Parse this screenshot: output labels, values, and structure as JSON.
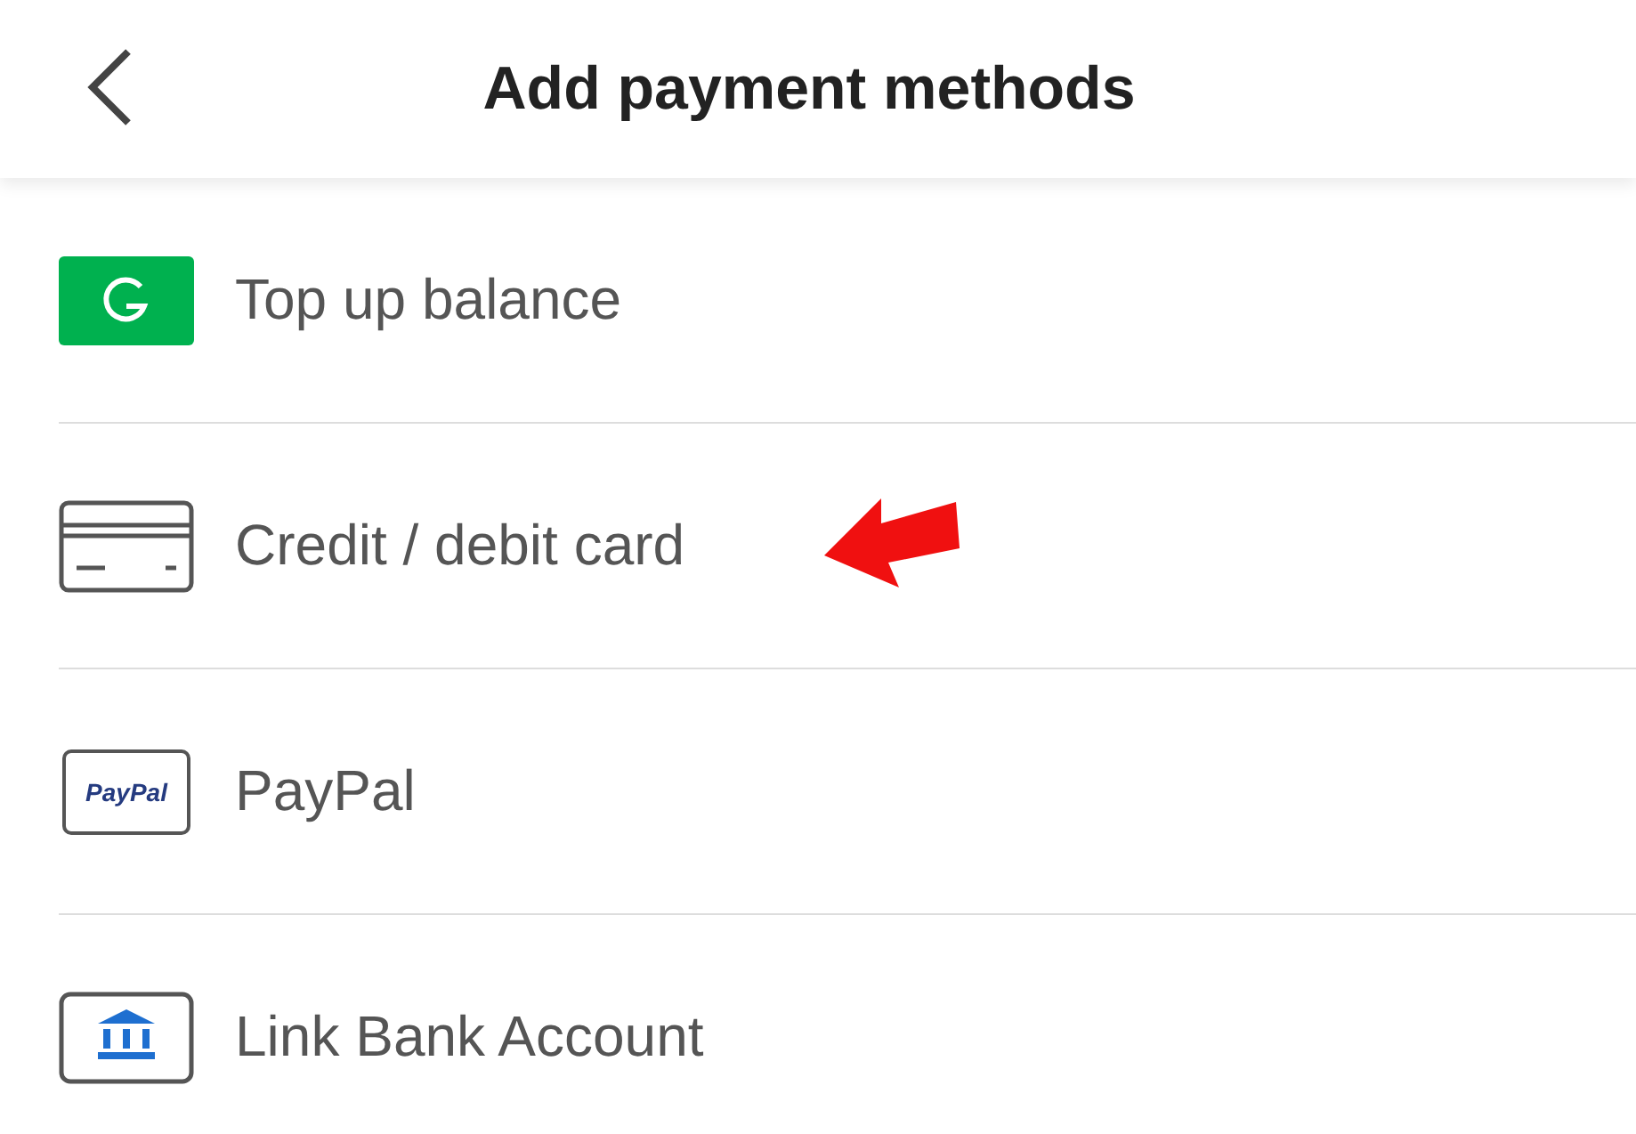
{
  "header": {
    "title": "Add payment methods"
  },
  "methods": [
    {
      "kind": "balance",
      "label": "Top up balance"
    },
    {
      "kind": "card",
      "label": "Credit / debit card",
      "annotated": true
    },
    {
      "kind": "paypal",
      "label": "PayPal",
      "logo_text": "PayPal"
    },
    {
      "kind": "bank",
      "label": "Link Bank Account"
    }
  ]
}
